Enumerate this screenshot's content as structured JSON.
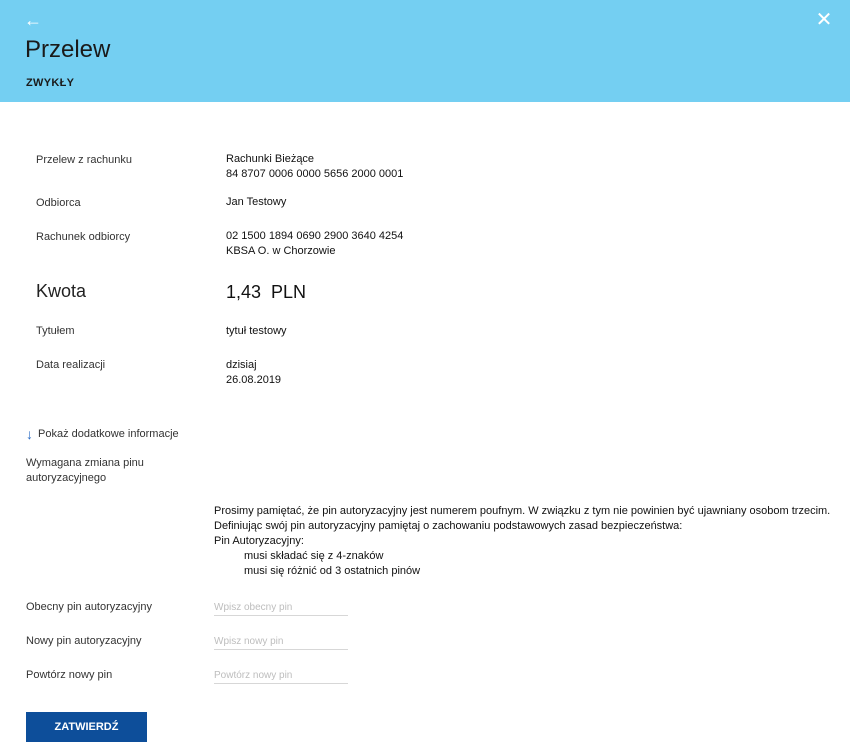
{
  "header": {
    "title": "Przelew",
    "subtitle": "ZWYKŁY",
    "back_icon": "←",
    "close_icon": "✕",
    "bg_color": "#74cff2"
  },
  "details": {
    "from_account_label": "Przelew z rachunku",
    "from_account_name": "Rachunki Bieżące",
    "from_account_number": "84 8707 0006 0000 5656 2000 0001",
    "recipient_label": "Odbiorca",
    "recipient_value": "Jan Testowy",
    "recipient_account_label": "Rachunek odbiorcy",
    "recipient_account_number": "02 1500 1894 0690 2900 3640 4254",
    "recipient_bank": "KBSA O. w Chorzowie",
    "amount_label": "Kwota",
    "amount_value": "1,43  PLN",
    "title_label": "Tytułem",
    "title_value": "tytuł testowy",
    "date_label": "Data realizacji",
    "date_value_1": "dzisiaj",
    "date_value_2": "26.08.2019"
  },
  "more_info": {
    "icon": "↓",
    "label": "Pokaż dodatkowe informacje"
  },
  "pin_change": {
    "required_line1": "Wymagana zmiana pinu",
    "required_line2": "autoryzacyjnego",
    "note_line1": "Prosimy pamiętać, że pin autoryzacyjny jest numerem poufnym. W związku z tym nie powinien być ujawniany osobom trzecim.",
    "note_line2": "Definiując swój pin autoryzacyjny pamiętaj o zachowaniu podstawowych zasad bezpieczeństwa:",
    "note_line3": "Pin Autoryzacyjny:",
    "rule1": "musi składać się z 4-znaków",
    "rule2": "musi się różnić od 3 ostatnich pinów",
    "current_pin_label": "Obecny pin autoryzacyjny",
    "current_pin_placeholder": "Wpisz obecny pin",
    "new_pin_label": "Nowy pin autoryzacyjny",
    "new_pin_placeholder": "Wpisz nowy pin",
    "repeat_pin_label": "Powtórz nowy pin",
    "repeat_pin_placeholder": "Powtórz nowy pin"
  },
  "actions": {
    "confirm_label": "ZATWIERDŹ",
    "confirm_color": "#0d4e9a"
  }
}
